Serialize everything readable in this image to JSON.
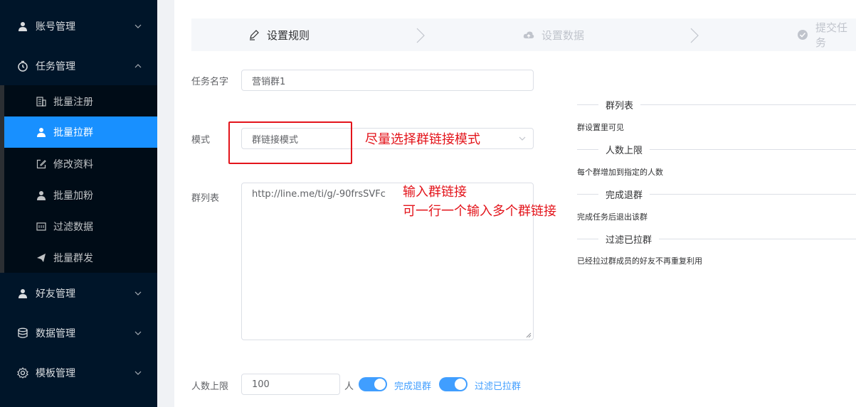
{
  "sidebar": {
    "groups": [
      {
        "label": "账号管理",
        "icon": "user-icon",
        "expanded": false
      },
      {
        "label": "任务管理",
        "icon": "clock-icon",
        "expanded": true
      },
      {
        "label": "好友管理",
        "icon": "user-icon",
        "expanded": false
      },
      {
        "label": "数据管理",
        "icon": "database-icon",
        "expanded": false
      },
      {
        "label": "模板管理",
        "icon": "gear-icon",
        "expanded": false
      }
    ],
    "task_items": [
      {
        "label": "批量注册",
        "icon": "building-icon"
      },
      {
        "label": "批量拉群",
        "icon": "user-icon",
        "active": true
      },
      {
        "label": "修改资料",
        "icon": "edit-icon"
      },
      {
        "label": "批量加粉",
        "icon": "user-icon"
      },
      {
        "label": "过滤数据",
        "icon": "filter-box-icon"
      },
      {
        "label": "批量群发",
        "icon": "send-icon"
      }
    ]
  },
  "steps": [
    {
      "label": "设置规则",
      "icon": "edit-pen-icon",
      "state": "current"
    },
    {
      "label": "设置数据",
      "icon": "cloud-upload-icon",
      "state": "todo"
    },
    {
      "label": "提交任务",
      "icon": "check-circle-icon",
      "state": "todo"
    }
  ],
  "form": {
    "task_name_label": "任务名字",
    "task_name_value": "营销群1",
    "mode_label": "模式",
    "mode_value": "群链接模式",
    "group_list_label": "群列表",
    "group_list_value": "http://line.me/ti/g/-90frsSVFc",
    "limit_label": "人数上限",
    "limit_value": "100",
    "limit_unit": "人",
    "switch_exit_label": "完成退群",
    "switch_filter_label": "过滤已拉群",
    "switch_exit_on": true,
    "switch_filter_on": true
  },
  "help": [
    {
      "title": "群列表",
      "desc": "群设置里可见"
    },
    {
      "title": "人数上限",
      "desc": "每个群增加到指定的人数"
    },
    {
      "title": "完成退群",
      "desc": "完成任务后退出该群"
    },
    {
      "title": "过滤已拉群",
      "desc": "已经拉过群成员的好友不再重复利用"
    }
  ],
  "annotations": {
    "mode_hint": "尽量选择群链接模式",
    "link_hint_1": "输入群链接",
    "link_hint_2": "可一行一个输入多个群链接"
  },
  "colors": {
    "sidebar_bg": "#001529",
    "submenu_bg": "#000c17",
    "active": "#1890ff",
    "switch_on": "#409eff",
    "annotation": "#e3141b"
  }
}
